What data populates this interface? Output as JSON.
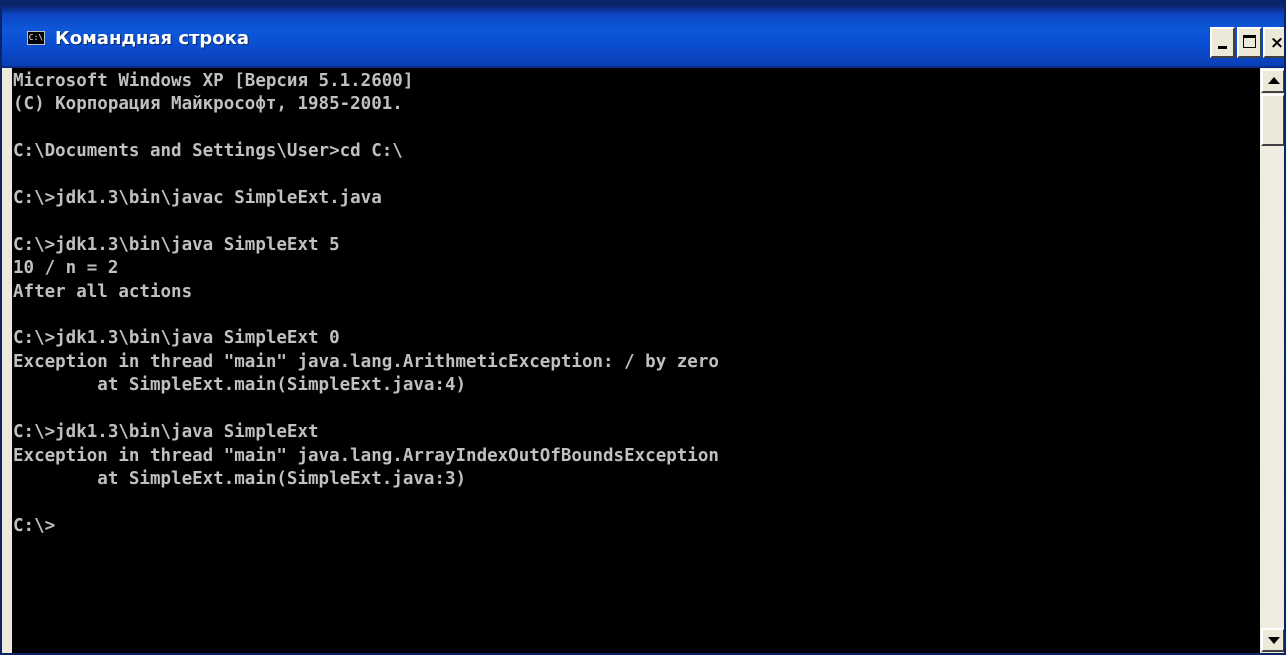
{
  "window": {
    "title": "Командная строка",
    "icon": "console-icon",
    "icon_label": "C:\\",
    "controls": {
      "minimize": "minimize-icon",
      "maximize": "maximize-icon",
      "close": "close-icon",
      "close_glyph": "×"
    }
  },
  "console": {
    "background": "#000000",
    "foreground": "#c0c0c0",
    "lines": [
      "Microsoft Windows XP [Версия 5.1.2600]",
      "(С) Корпорация Майкрософт, 1985-2001.",
      "",
      "C:\\Documents and Settings\\User>cd C:\\",
      "",
      "C:\\>jdk1.3\\bin\\javac SimpleExt.java",
      "",
      "C:\\>jdk1.3\\bin\\java SimpleExt 5",
      "10 / n = 2",
      "After all actions",
      "",
      "C:\\>jdk1.3\\bin\\java SimpleExt 0",
      "Exception in thread \"main\" java.lang.ArithmeticException: / by zero",
      "        at SimpleExt.main(SimpleExt.java:4)",
      "",
      "C:\\>jdk1.3\\bin\\java SimpleExt",
      "Exception in thread \"main\" java.lang.ArrayIndexOutOfBoundsException",
      "        at SimpleExt.main(SimpleExt.java:3)",
      "",
      "C:\\>"
    ]
  },
  "scrollbar": {
    "up": "scroll-up-arrow-icon",
    "down": "scroll-down-arrow-icon"
  },
  "colors": {
    "titlebar": "#0b4cd0",
    "window_frame": "#ece9d8"
  }
}
